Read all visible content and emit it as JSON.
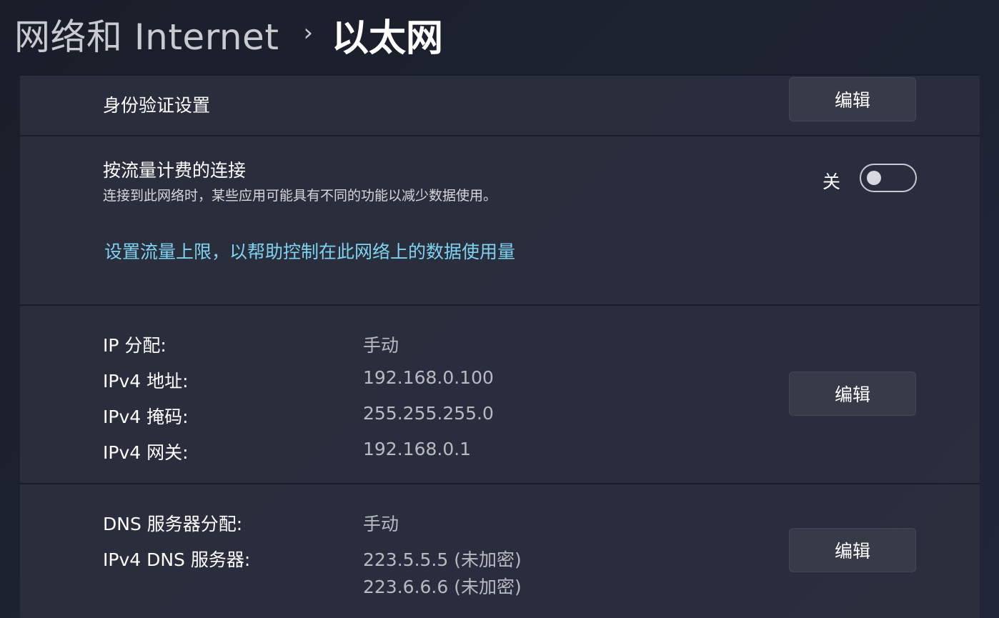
{
  "breadcrumb": {
    "parent": "网络和 Internet",
    "separator": "›",
    "current": "以太网"
  },
  "auth": {
    "title": "身份验证设置",
    "button": "编辑"
  },
  "metered": {
    "title": "按流量计费的连接",
    "description": "连接到此网络时，某些应用可能具有不同的功能以减少数据使用。",
    "toggle_state": "关",
    "toggle_on": false,
    "link": "设置流量上限，以帮助控制在此网络上的数据使用量"
  },
  "ip": {
    "rows": [
      {
        "label": "IP 分配:",
        "value": "手动"
      },
      {
        "label": "IPv4 地址:",
        "value": "192.168.0.100"
      },
      {
        "label": "IPv4 掩码:",
        "value": "255.255.255.0"
      },
      {
        "label": "IPv4 网关:",
        "value": "192.168.0.1"
      }
    ],
    "button": "编辑"
  },
  "dns": {
    "assignment_label": "DNS 服务器分配:",
    "assignment_value": "手动",
    "servers_label": "IPv4 DNS 服务器:",
    "servers": [
      "223.5.5.5 (未加密)",
      "223.6.6.6 (未加密)"
    ],
    "button": "编辑"
  },
  "colors": {
    "link": "#7ed3f0",
    "card_bg": "#2b2f3e",
    "button_bg": "#373b48"
  }
}
